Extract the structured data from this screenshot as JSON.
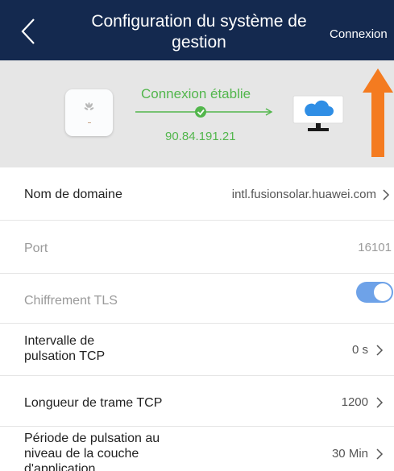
{
  "header": {
    "title": "Configuration du système de gestion",
    "action_label": "Connexion",
    "bg_color": "#14294f"
  },
  "status": {
    "connection_text": "Connexion établie",
    "ip_address": "90.84.191.21",
    "status_color": "#52b64c",
    "device_icon": "huawei-logo-icon",
    "cloud_icon": "cloud-monitor-icon",
    "annotation_arrow_color": "#f47b20"
  },
  "settings": {
    "domain": {
      "label": "Nom de domaine",
      "value": "intl.fusionsolar.huawei.com"
    },
    "port": {
      "label": "Port",
      "value": "16101"
    },
    "tls": {
      "label": "Chiffrement TLS",
      "enabled": true
    },
    "tcp_heartbeat": {
      "label": "Intervalle de pulsation TCP",
      "value": "0 s"
    },
    "tcp_frame": {
      "label": "Longueur de trame TCP",
      "value": "1200"
    },
    "app_heartbeat": {
      "label": "Période de pulsation au niveau de la couche d'application",
      "value": "30 Min"
    }
  }
}
